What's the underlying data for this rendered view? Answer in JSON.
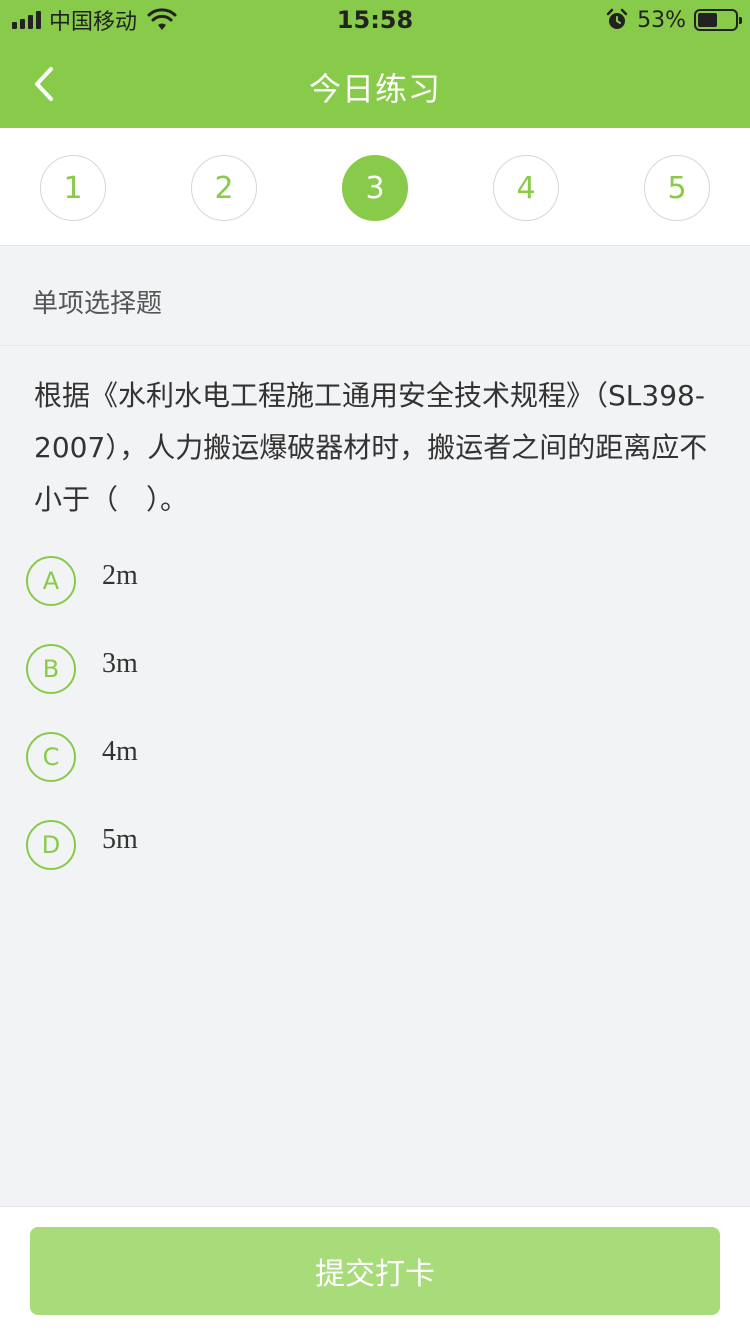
{
  "status_bar": {
    "carrier": "中国移动",
    "time": "15:58",
    "battery_percent": "53%",
    "battery_level": 0.53,
    "icons": [
      "signal-icon",
      "wifi-icon",
      "alarm-icon",
      "battery-icon"
    ]
  },
  "nav": {
    "title": "今日练习",
    "back_icon": "chevron-left-icon"
  },
  "steps": {
    "items": [
      "1",
      "2",
      "3",
      "4",
      "5"
    ],
    "active_index": 2
  },
  "question": {
    "type_label": "单项选择题",
    "text": "根据《水利水电工程施工通用安全技术规程》（SL398-2007），人力搬运爆破器材时，搬运者之间的距离应不小于（　）。",
    "options": [
      {
        "letter": "A",
        "text": "2m"
      },
      {
        "letter": "B",
        "text": "3m"
      },
      {
        "letter": "C",
        "text": "4m"
      },
      {
        "letter": "D",
        "text": "5m"
      }
    ]
  },
  "footer": {
    "submit_label": "提交打卡"
  },
  "colors": {
    "brand_green": "#88cb4a",
    "submit_disabled": "#a8db79",
    "background": "#f2f3f5"
  }
}
